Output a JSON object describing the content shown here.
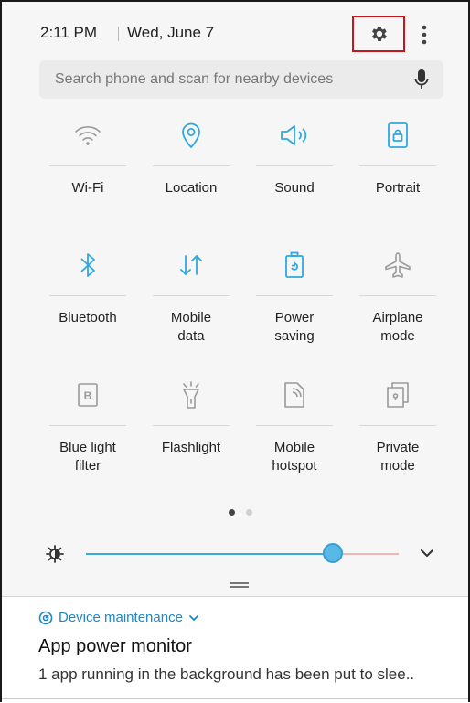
{
  "status": {
    "time": "2:11 PM",
    "date": "Wed, June 7"
  },
  "header": {
    "settings_icon": "gear-icon",
    "more_icon": "more-vertical-icon"
  },
  "search": {
    "placeholder": "Search phone and scan for nearby devices",
    "mic_icon": "mic-icon"
  },
  "tiles": [
    {
      "label": "Wi-Fi",
      "icon": "wifi-icon",
      "active": false
    },
    {
      "label": "Location",
      "icon": "location-icon",
      "active": true
    },
    {
      "label": "Sound",
      "icon": "sound-icon",
      "active": true
    },
    {
      "label": "Portrait",
      "icon": "portrait-lock-icon",
      "active": true
    },
    {
      "label": "Bluetooth",
      "icon": "bluetooth-icon",
      "active": true
    },
    {
      "label": "Mobile\ndata",
      "icon": "mobile-data-icon",
      "active": true
    },
    {
      "label": "Power\nsaving",
      "icon": "power-saving-icon",
      "active": true
    },
    {
      "label": "Airplane\nmode",
      "icon": "airplane-icon",
      "active": false
    },
    {
      "label": "Blue light\nfilter",
      "icon": "blue-light-filter-icon",
      "active": false
    },
    {
      "label": "Flashlight",
      "icon": "flashlight-icon",
      "active": false
    },
    {
      "label": "Mobile\nhotspot",
      "icon": "hotspot-icon",
      "active": false
    },
    {
      "label": "Private\nmode",
      "icon": "private-mode-icon",
      "active": false
    }
  ],
  "pager": {
    "pages": 2,
    "current": 1
  },
  "brightness": {
    "level": 0.79,
    "icon": "brightness-icon",
    "expand_icon": "chevron-down-icon"
  },
  "notification": {
    "app": "Device maintenance",
    "app_icon": "device-maintenance-icon",
    "title": "App power monitor",
    "body": "1 app running in the background has been put to slee.."
  },
  "colors": {
    "accent": "#3aa9dc",
    "inactive_icon": "#9a9a9a",
    "highlight_box": "#c8151d"
  }
}
